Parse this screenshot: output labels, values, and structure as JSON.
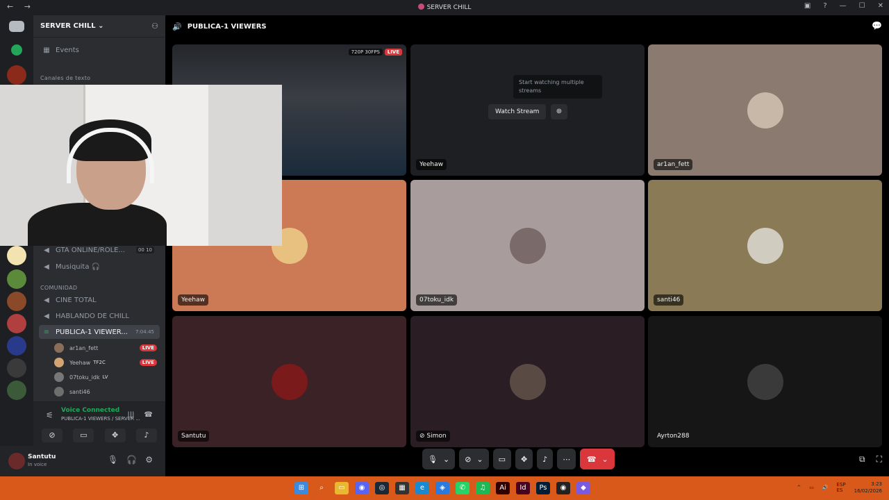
{
  "titlebar": {
    "title": "SERVER CHILL",
    "nav": "← →"
  },
  "server": {
    "name": "SERVER CHILL"
  },
  "sidebar": {
    "events": "Events",
    "cat_text": "Canales de texto",
    "channels": [
      {
        "label": "GTA ONLINE/ROLE...",
        "count": "00 10"
      },
      {
        "label": "Musiquita"
      }
    ],
    "cat_comunidad": "COMUNIDAD",
    "channels2": [
      {
        "label": "CINE TOTAL"
      },
      {
        "label": "HABLANDO DE CHILL"
      },
      {
        "label": "PUBLICA-1 VIEWER...",
        "timer": "7:04:45"
      }
    ],
    "members": [
      {
        "name": "ar1an_fett",
        "live": "LIVE",
        "color": "#8a6e5a"
      },
      {
        "name": "Yeehaw",
        "tag": "TF2C",
        "live": "LIVE",
        "color": "#d4a373"
      },
      {
        "name": "07toku_idk",
        "tag": "LV",
        "color": "#777"
      },
      {
        "name": "santi46",
        "color": "#6e6e6e"
      }
    ]
  },
  "voice": {
    "title": "Voice Connected",
    "subtitle": "PUBLICA-1 VIEWERS / SERVER ..."
  },
  "user": {
    "name": "Santutu",
    "status": "In voice"
  },
  "main": {
    "channel": "PUBLICA-1 VIEWERS"
  },
  "tiles": {
    "stream": {
      "quality": "720P 30FPS",
      "live": "LIVE"
    },
    "yeehaw_stream": {
      "label": "Yeehaw",
      "watch": "Watch Stream",
      "tooltip": "Start watching multiple streams"
    },
    "arlan": {
      "label": "ar1an_fett"
    },
    "yeehaw": {
      "label": "Yeehaw"
    },
    "toku": {
      "label": "07toku_idk"
    },
    "santi": {
      "label": "santi46"
    },
    "santutu": {
      "label": "Santutu"
    },
    "simon": {
      "label": "Simon"
    },
    "ayrton": {
      "label": "Ayrton288"
    }
  },
  "taskbar": {
    "lang": "ESP\nES",
    "time": "3:23",
    "date": "16/02/2026"
  }
}
